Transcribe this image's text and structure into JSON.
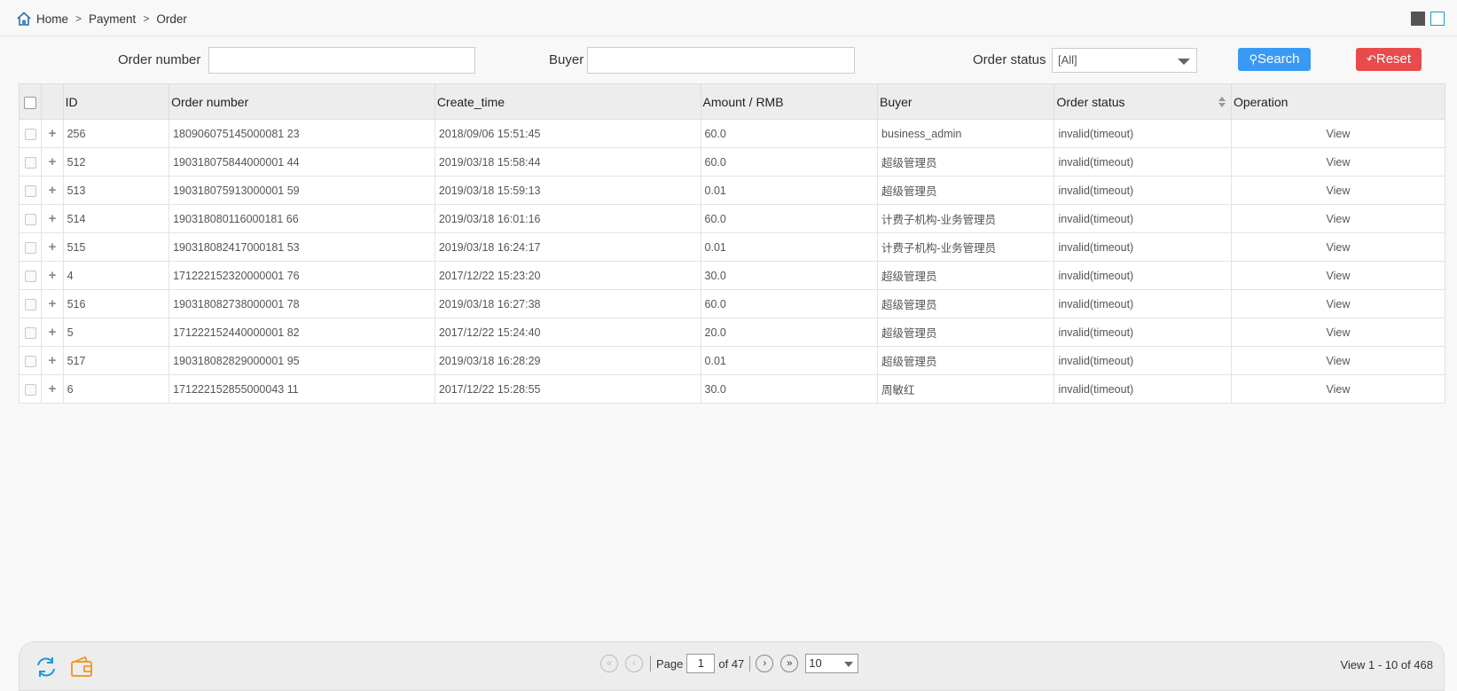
{
  "breadcrumb": {
    "home": "Home",
    "payment": "Payment",
    "order": "Order",
    "separator": ">"
  },
  "filters": {
    "order_number_label": "Order number",
    "order_number_value": "",
    "buyer_label": "Buyer",
    "buyer_value": "",
    "order_status_label": "Order status",
    "order_status_selected": "[All]",
    "search_label": "Search",
    "reset_label": "Reset"
  },
  "table": {
    "columns": [
      "ID",
      "Order number",
      "Create_time",
      "Amount / RMB",
      "Buyer",
      "Order status",
      "Operation"
    ],
    "rows": [
      {
        "id": "256",
        "order_number": "180906075145000081 23",
        "create_time": "2018/09/06 15:51:45",
        "amount": "60.0",
        "buyer": "business_admin",
        "status": "invalid(timeout)",
        "op": "View"
      },
      {
        "id": "512",
        "order_number": "190318075844000001 44",
        "create_time": "2019/03/18 15:58:44",
        "amount": "60.0",
        "buyer": "超级管理员",
        "status": "invalid(timeout)",
        "op": "View"
      },
      {
        "id": "513",
        "order_number": "190318075913000001 59",
        "create_time": "2019/03/18 15:59:13",
        "amount": "0.01",
        "buyer": "超级管理员",
        "status": "invalid(timeout)",
        "op": "View"
      },
      {
        "id": "514",
        "order_number": "190318080116000181 66",
        "create_time": "2019/03/18 16:01:16",
        "amount": "60.0",
        "buyer": "计费子机构-业务管理员",
        "status": "invalid(timeout)",
        "op": "View"
      },
      {
        "id": "515",
        "order_number": "190318082417000181 53",
        "create_time": "2019/03/18 16:24:17",
        "amount": "0.01",
        "buyer": "计费子机构-业务管理员",
        "status": "invalid(timeout)",
        "op": "View"
      },
      {
        "id": "4",
        "order_number": "171222152320000001 76",
        "create_time": "2017/12/22 15:23:20",
        "amount": "30.0",
        "buyer": "超级管理员",
        "status": "invalid(timeout)",
        "op": "View"
      },
      {
        "id": "516",
        "order_number": "190318082738000001 78",
        "create_time": "2019/03/18 16:27:38",
        "amount": "60.0",
        "buyer": "超级管理员",
        "status": "invalid(timeout)",
        "op": "View"
      },
      {
        "id": "5",
        "order_number": "171222152440000001 82",
        "create_time": "2017/12/22 15:24:40",
        "amount": "20.0",
        "buyer": "超级管理员",
        "status": "invalid(timeout)",
        "op": "View"
      },
      {
        "id": "517",
        "order_number": "190318082829000001 95",
        "create_time": "2019/03/18 16:28:29",
        "amount": "0.01",
        "buyer": "超级管理员",
        "status": "invalid(timeout)",
        "op": "View"
      },
      {
        "id": "6",
        "order_number": "171222152855000043 11",
        "create_time": "2017/12/22 15:28:55",
        "amount": "30.0",
        "buyer": "周敏红",
        "status": "invalid(timeout)",
        "op": "View"
      }
    ]
  },
  "pager": {
    "page_label": "Page",
    "page_value": "1",
    "of_label": "of 47",
    "page_size": "10",
    "view_info": "View 1 - 10 of 468"
  },
  "colors": {
    "search_button": "#3a99f4",
    "reset_button": "#e84b4b",
    "refresh_icon": "#1a9bd6",
    "wallet_icon": "#f39a2c"
  },
  "icons": [
    "home-icon",
    "search-icon",
    "reset-icon",
    "refresh-icon",
    "wallet-icon",
    "first-page-icon",
    "prev-page-icon",
    "next-page-icon",
    "last-page-icon"
  ]
}
